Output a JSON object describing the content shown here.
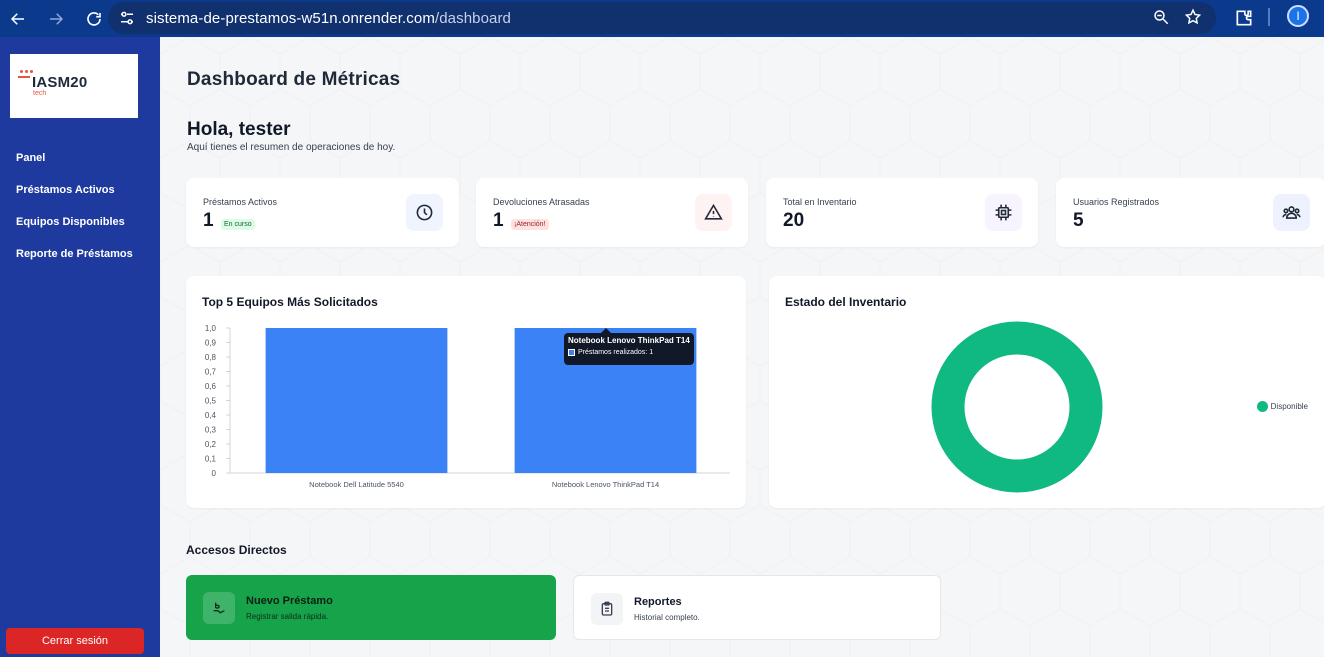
{
  "browser": {
    "url_host": "sistema-de-prestamos-w51n.onrender.com",
    "url_path": "/dashboard",
    "avatar_letter": "I"
  },
  "sidebar": {
    "logo_text": "IASM20",
    "logo_sub": "tech",
    "items": [
      {
        "label": "Panel"
      },
      {
        "label": "Préstamos Activos"
      },
      {
        "label": "Equipos Disponibles"
      },
      {
        "label": "Reporte de Préstamos"
      }
    ],
    "logout_label": "Cerrar sesión"
  },
  "header": {
    "title": "Dashboard de Métricas",
    "greeting": "Hola, tester",
    "subtitle": "Aquí tienes el resumen de operaciones de hoy."
  },
  "stats": [
    {
      "label": "Préstamos Activos",
      "value": "1",
      "badge": "En curso",
      "icon": "clock-icon",
      "color": "#2563eb"
    },
    {
      "label": "Devoluciones Atrasadas",
      "value": "1",
      "badge": "¡Atención!",
      "icon": "warning-icon",
      "color": "#dc2626"
    },
    {
      "label": "Total en Inventario",
      "value": "20",
      "badge": "",
      "icon": "chip-icon",
      "color": "#7c3aed"
    },
    {
      "label": "Usuarios Registrados",
      "value": "5",
      "badge": "",
      "icon": "users-icon",
      "color": "#4f46e5"
    }
  ],
  "bar_chart_title": "Top 5 Equipos Más Solicitados",
  "donut_title": "Estado del Inventario",
  "chart_data": [
    {
      "type": "bar",
      "title": "Top 5 Equipos Más Solicitados",
      "categories": [
        "Notebook Dell Latitude 5540",
        "Notebook Lenovo ThinkPad T14"
      ],
      "series": [
        {
          "name": "Préstamos realizados",
          "values": [
            1,
            1
          ]
        }
      ],
      "yticks": [
        "1,0",
        "0,9",
        "0,8",
        "0,7",
        "0,6",
        "0,5",
        "0,4",
        "0,3",
        "0,2",
        "0,1",
        "0"
      ],
      "ylim": [
        0,
        1
      ],
      "color": "#3b82f6",
      "grid": false,
      "tooltip": {
        "title": "Notebook Lenovo ThinkPad T14",
        "line": "Préstamos realizados: 1"
      }
    },
    {
      "type": "pie",
      "title": "Estado del Inventario",
      "labels": [
        "Disponible"
      ],
      "values": [
        1
      ],
      "colors": [
        "#10b981"
      ],
      "legend": "right"
    }
  ],
  "quick_access": {
    "title": "Accesos Directos",
    "items": [
      {
        "title": "Nuevo Préstamo",
        "subtitle": "Registrar salida rápida.",
        "icon": "hand-icon"
      },
      {
        "title": "Reportes",
        "subtitle": "Historial completo.",
        "icon": "clipboard-icon"
      }
    ]
  },
  "colors": {
    "sidebar": "#1e3a9f",
    "accent_blue": "#3b82f6",
    "success_green": "#16a34a",
    "danger_red": "#dc2626",
    "donut_green": "#10b981"
  }
}
